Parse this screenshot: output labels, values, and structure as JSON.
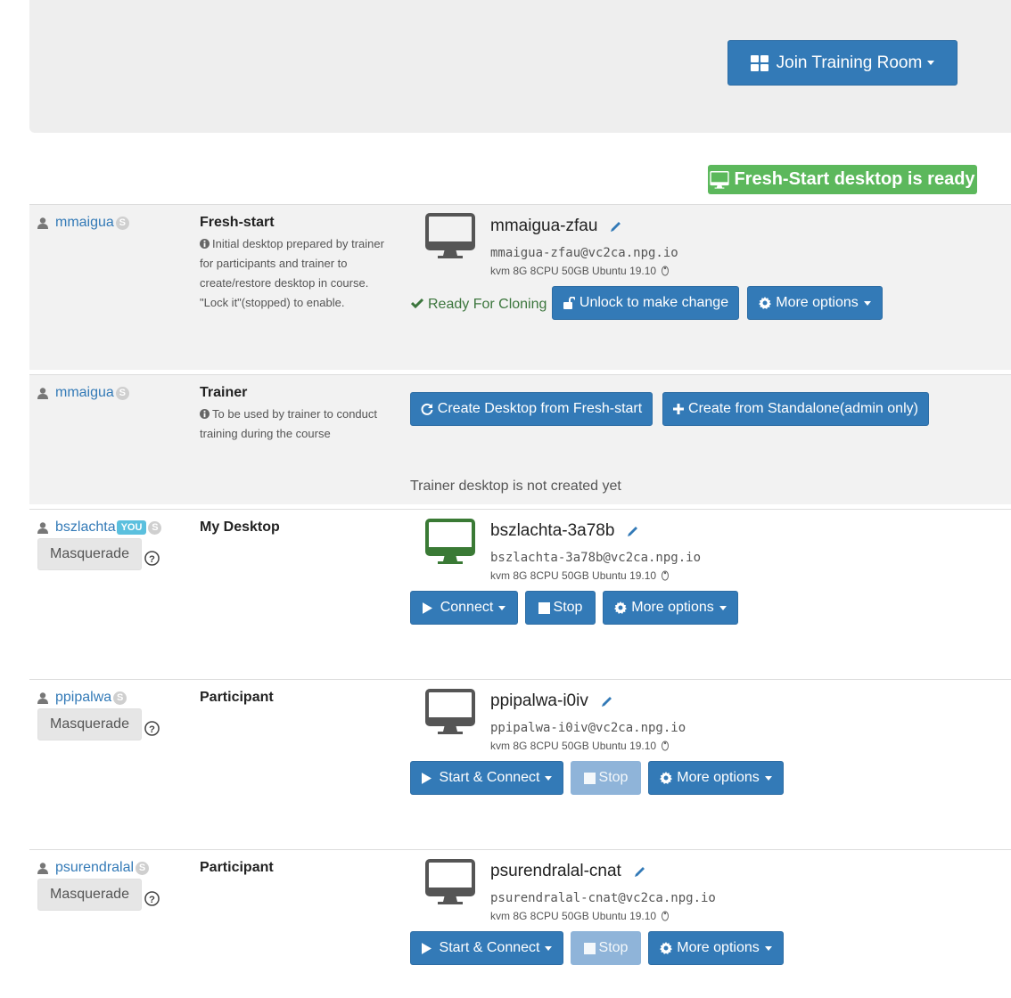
{
  "header": {
    "join_label": "Join Training Room",
    "ready_banner": "Fresh-Start desktop is ready"
  },
  "rows": [
    {
      "user": "mmaigua",
      "badge": "S",
      "role": "Fresh-start",
      "desc": "Initial desktop prepared by trainer for participants and trainer to create/restore desktop in course. \"Lock it\"(stopped) to enable.",
      "desktop_name": "mmaigua-zfau",
      "desktop_host": "mmaigua-zfau@vc2ca.npg.io",
      "desktop_spec": "kvm 8G 8CPU 50GB Ubuntu 19.10",
      "status": "Ready For Cloning",
      "unlock_label": "Unlock to make change",
      "more_label": "More options"
    },
    {
      "user": "mmaigua",
      "badge": "S",
      "role": "Trainer",
      "desc": "To be used by trainer to conduct training during the course",
      "create_fresh_label": "Create Desktop from Fresh-start",
      "create_standalone_label": "Create from Standalone(admin only)",
      "not_created": "Trainer desktop is not created yet"
    },
    {
      "user": "bszlachta",
      "you_badge": "YOU",
      "badge": "S",
      "role": "My Desktop",
      "masquerade": "Masquerade",
      "desktop_name": "bszlachta-3a78b",
      "desktop_host": "bszlachta-3a78b@vc2ca.npg.io",
      "desktop_spec": "kvm 8G 8CPU 50GB Ubuntu 19.10",
      "connect_label": "Connect",
      "stop_label": "Stop",
      "more_label": "More options"
    },
    {
      "user": "ppipalwa",
      "badge": "S",
      "role": "Participant",
      "masquerade": "Masquerade",
      "desktop_name": "ppipalwa-i0iv",
      "desktop_host": "ppipalwa-i0iv@vc2ca.npg.io",
      "desktop_spec": "kvm 8G 8CPU 50GB Ubuntu 19.10",
      "connect_label": "Start & Connect",
      "stop_label": "Stop",
      "more_label": "More options"
    },
    {
      "user": "psurendralal",
      "badge": "S",
      "role": "Participant",
      "masquerade": "Masquerade",
      "desktop_name": "psurendralal-cnat",
      "desktop_host": "psurendralal-cnat@vc2ca.npg.io",
      "desktop_spec": "kvm 8G 8CPU 50GB Ubuntu 19.10",
      "connect_label": "Start & Connect",
      "stop_label": "Stop",
      "more_label": "More options"
    }
  ],
  "colors": {
    "primary": "#337ab7",
    "success": "#5cb85c",
    "monitor_running": "#3a7a35",
    "monitor_stopped": "#555555"
  }
}
